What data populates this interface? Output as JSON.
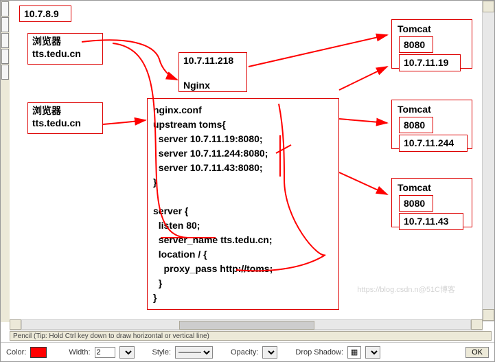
{
  "diagram": {
    "client_ip": "10.7.8.9",
    "browser1_title": "浏览器",
    "browser1_host": "tts.tedu.cn",
    "browser2_title": "浏览器",
    "browser2_host": "tts.tedu.cn",
    "nginx_ip": "10.7.11.218",
    "nginx_label": "Nginx",
    "nginx_conf": "nginx.conf\nupstream toms{\n  server 10.7.11.19:8080;\n  server 10.7.11.244:8080;\n  server 10.7.11.43:8080;\n}\n\nserver {\n  listen 80;\n  server_name tts.tedu.cn;\n  location / {\n    proxy_pass http://toms;\n  }\n}",
    "tomcat": [
      {
        "label": "Tomcat",
        "port": "8080",
        "ip": "10.7.11.19"
      },
      {
        "label": "Tomcat",
        "port": "8080",
        "ip": "10.7.11.244"
      },
      {
        "label": "Tomcat",
        "port": "8080",
        "ip": "10.7.11.43"
      }
    ]
  },
  "editor": {
    "hint": "Pencil (Tip: Hold Ctrl key down to draw horizontal or vertical line)",
    "labels": {
      "color": "Color:",
      "width": "Width:",
      "style": "Style:",
      "opacity": "Opacity:",
      "dropshadow": "Drop Shadow:",
      "ok": "OK"
    },
    "values": {
      "width": "2",
      "style": "———",
      "color": "#ff0000"
    },
    "watermark": "https://blog.csdn.n@51C博客"
  }
}
